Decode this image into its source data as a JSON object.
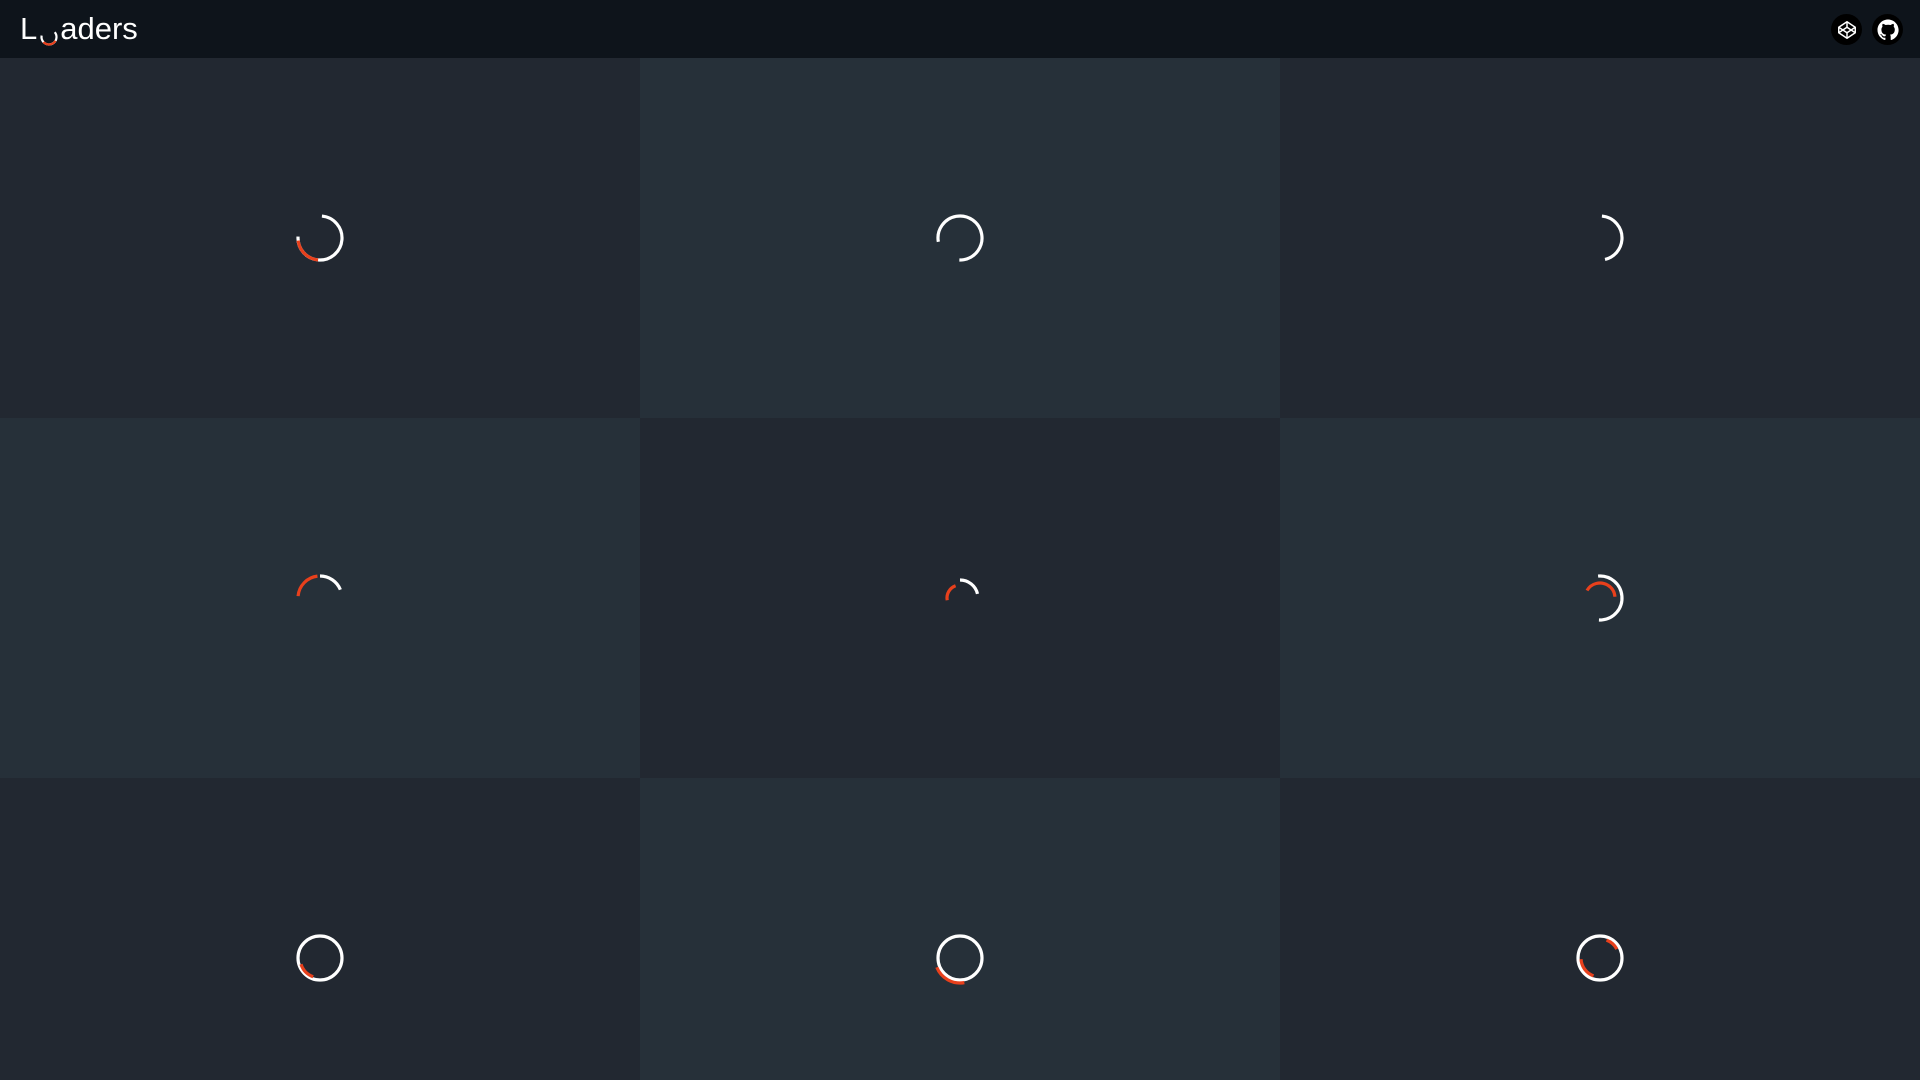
{
  "header": {
    "title_prefix": "L",
    "title_suffix": "aders",
    "codepen_label": "codepen-icon",
    "github_label": "github-icon"
  },
  "colors": {
    "background_dark": "#222831",
    "background_light": "#263039",
    "header": "#0e141b",
    "white": "#ffffff",
    "accent": "#e8401c"
  },
  "loaders": [
    {
      "name": "loader-1"
    },
    {
      "name": "loader-2"
    },
    {
      "name": "loader-3"
    },
    {
      "name": "loader-4"
    },
    {
      "name": "loader-5"
    },
    {
      "name": "loader-6"
    },
    {
      "name": "loader-7"
    },
    {
      "name": "loader-8"
    },
    {
      "name": "loader-9"
    }
  ]
}
